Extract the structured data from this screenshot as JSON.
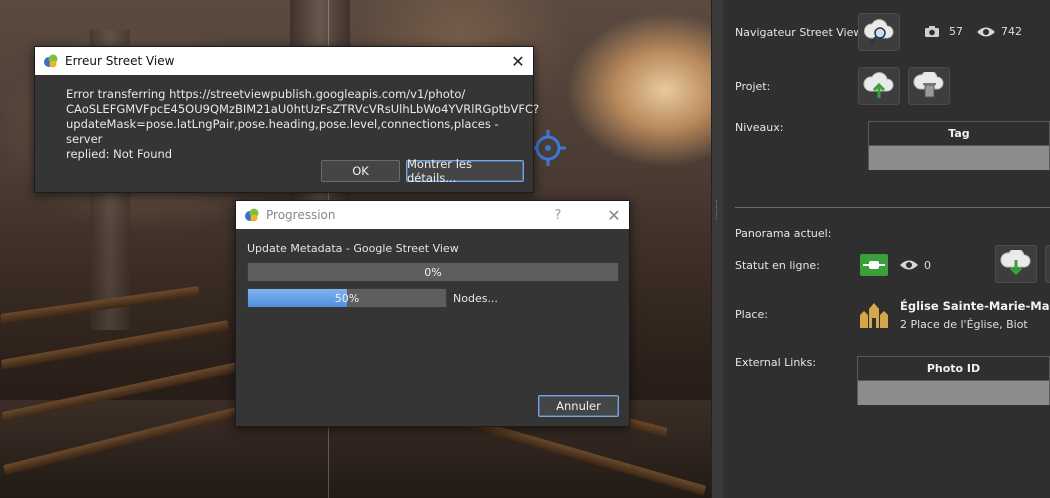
{
  "right_panel": {
    "navigator_label": "Navigateur Street View:",
    "photo_count": "57",
    "view_count": "742",
    "project_label": "Projet:",
    "levels_label": "Niveaux:",
    "levels_table_header": "Tag",
    "current_panorama_label": "Panorama actuel:",
    "online_status_label": "Statut en ligne:",
    "online_view_count": "0",
    "place_label": "Place:",
    "place_name": "Église Sainte-Marie-Madele",
    "place_address": "2 Place de l'Église, Biot",
    "external_links_label": "External Links:",
    "external_links_header": "Photo ID"
  },
  "error_dialog": {
    "title": "Erreur Street View",
    "message_lines": [
      "Error transferring https://streetviewpublish.googleapis.com/v1/photo/",
      "CAoSLEFGMVFpcE45OU9QMzBIM21aU0htUzFsZTRVcVRsUlhLbWo4YVRlRGptbVFC?",
      "updateMask=pose.latLngPair,pose.heading,pose.level,connections,places - server",
      "replied: Not Found"
    ],
    "ok_label": "OK",
    "details_label": "Montrer les détails..."
  },
  "progress_dialog": {
    "title": "Progression",
    "help": "?",
    "task_label": "Update Metadata - Google Street View",
    "overall_progress": 0,
    "overall_progress_text": "0%",
    "nodes_progress": 50,
    "nodes_progress_text": "50%",
    "nodes_label": "Nodes...",
    "cancel_label": "Annuler"
  },
  "icons": {
    "navigator": "cloud-search-icon",
    "camera": "camera-icon",
    "eye": "eye-icon",
    "upload": "cloud-upload-icon",
    "delete": "cloud-trash-icon",
    "online": "connected-plug-icon",
    "download": "cloud-download-icon",
    "place": "church-icon",
    "target": "crosshair-icon"
  },
  "colors": {
    "accent": "#4f8fdf",
    "online_green": "#3aa03a",
    "place_gold": "#d4a84a"
  }
}
